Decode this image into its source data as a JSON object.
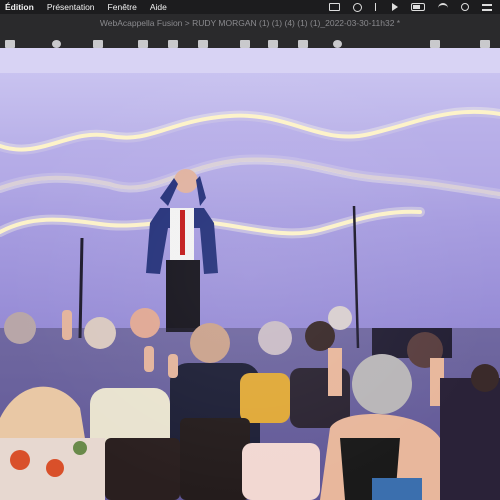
{
  "menubar": {
    "app_menu": "Édition",
    "items": [
      "Présentation",
      "Fenêtre",
      "Aide"
    ],
    "status_icons": [
      "screen-mirror-icon",
      "time-machine-icon",
      "bluetooth-icon",
      "play-icon",
      "battery-icon",
      "wifi-icon",
      "search-icon",
      "control-center-icon"
    ]
  },
  "window": {
    "title": "WebAcappella Fusion > RUDY MORGAN (1) (1) (4) (1) (1)_2022-03-30-11h32 *"
  },
  "toolbar": {
    "tools": [
      "sidebar-icon",
      "loop-icon",
      "grid-icon",
      "frame-icon",
      "crop-icon",
      "media-icon",
      "tile-icon",
      "list-icon",
      "layout-icon",
      "zoom-icon",
      "settings-icon",
      "share-icon"
    ]
  },
  "colors": {
    "menubar_bg": "#1c1c1e",
    "titlebar_bg": "#2a2a2c",
    "stage_wall": "#9a8fd8",
    "led_strip": "#fff3c2"
  }
}
